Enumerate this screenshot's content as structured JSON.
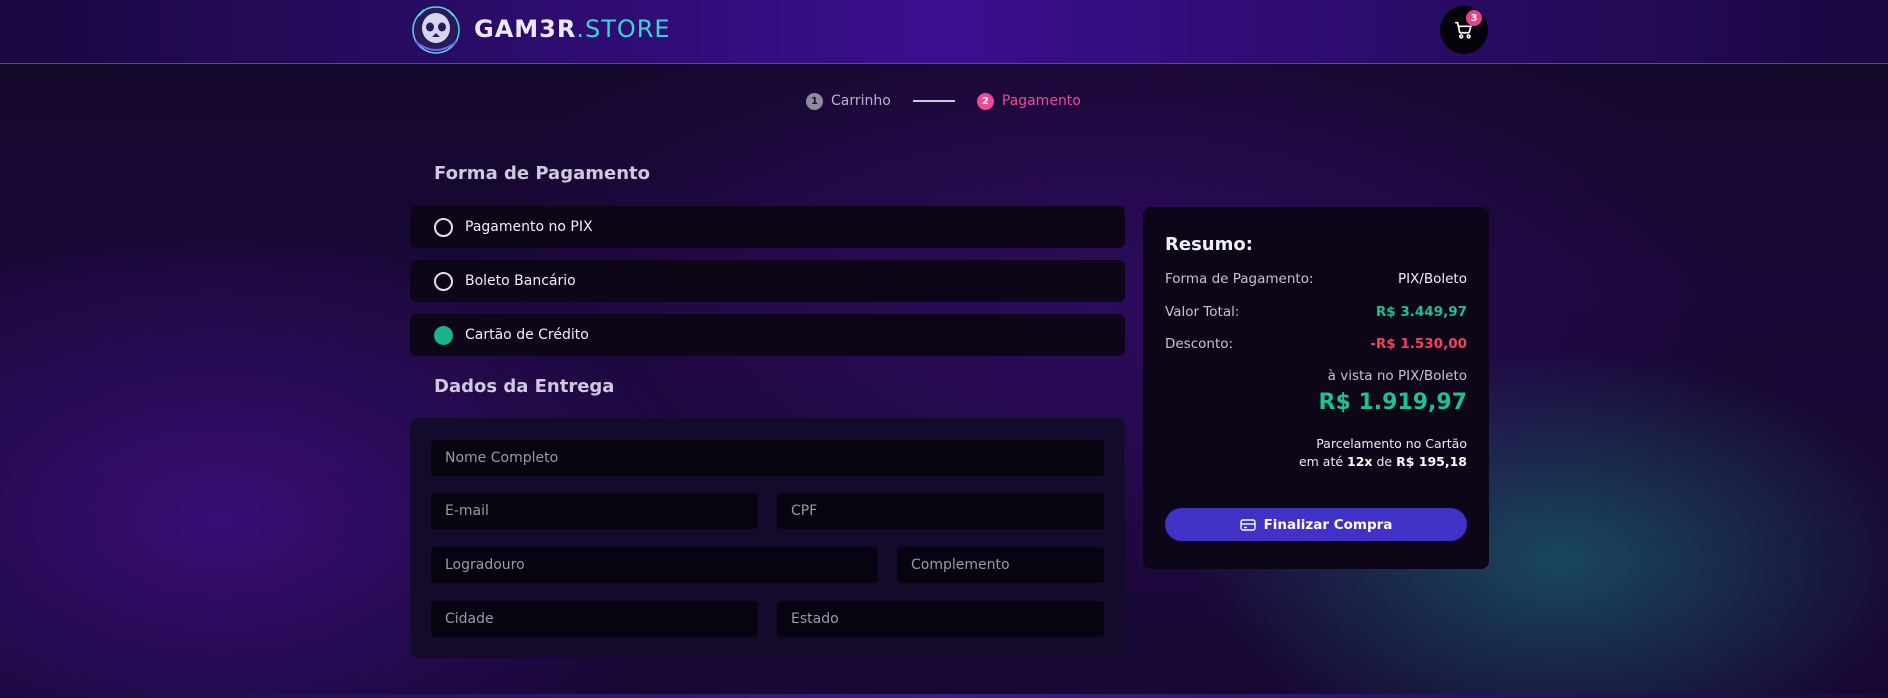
{
  "header": {
    "logo_main": "GAM3R",
    "logo_sub": ".STORE",
    "cart_count": "3"
  },
  "stepper": {
    "steps": [
      {
        "num": "1",
        "label": "Carrinho"
      },
      {
        "num": "2",
        "label": "Pagamento"
      }
    ]
  },
  "payment": {
    "title": "Forma de Pagamento",
    "options": [
      {
        "label": "Pagamento no PIX",
        "selected": false
      },
      {
        "label": "Boleto Bancário",
        "selected": false
      },
      {
        "label": "Cartão de Crédito",
        "selected": true
      }
    ]
  },
  "delivery": {
    "title": "Dados da Entrega",
    "fields": {
      "name": "Nome Completo",
      "email": "E-mail",
      "cpf": "CPF",
      "street": "Logradouro",
      "complement": "Complemento",
      "city": "Cidade",
      "state": "Estado"
    }
  },
  "summary": {
    "title": "Resumo:",
    "payment_method_label": "Forma de Pagamento:",
    "payment_method_value": "PIX/Boleto",
    "total_label": "Valor Total:",
    "total_value": "R$ 3.449,97",
    "discount_label": "Desconto:",
    "discount_value": "-R$ 1.530,00",
    "cash_label": "à vista no PIX/Boleto",
    "cash_price": "R$ 1.919,97",
    "installment_title": "Parcelamento no Cartão",
    "installment_prefix": "em até",
    "installment_count": "12x",
    "installment_mid": "de",
    "installment_value": "R$ 195,18",
    "finalize_label": "Finalizar Compra"
  },
  "colors": {
    "accent_green": "#1fc28f",
    "accent_pink": "#ee4b94",
    "accent_red": "#f0435c",
    "button": "#4032c7"
  }
}
